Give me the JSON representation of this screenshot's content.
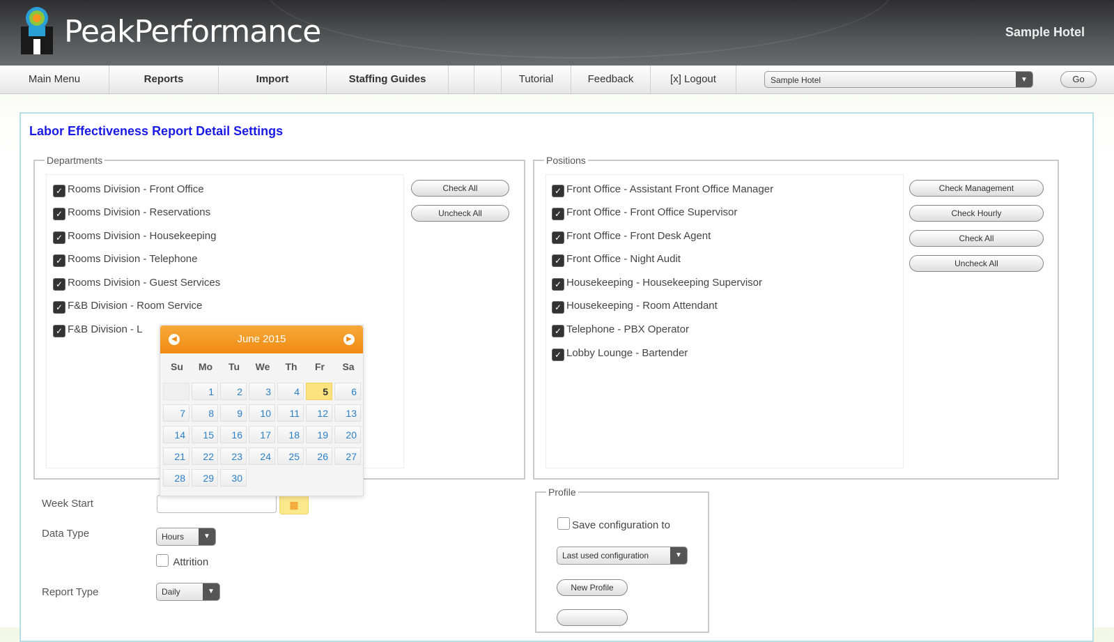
{
  "header": {
    "brand_bold": "Peak",
    "brand_light": "Performance",
    "hotel_name": "Sample Hotel"
  },
  "nav": {
    "items": [
      "Main Menu",
      "Reports",
      "Import",
      "Staffing Guides",
      "",
      "",
      "Tutorial",
      "Feedback",
      "[x] Logout"
    ],
    "hotel_select": "Sample Hotel",
    "go": "Go"
  },
  "page_title": "Labor Effectiveness Report Detail Settings",
  "departments": {
    "legend": "Departments",
    "items": [
      "Rooms Division - Front Office",
      "Rooms Division - Reservations",
      "Rooms Division - Housekeeping",
      "Rooms Division - Telephone",
      "Rooms Division - Guest Services",
      "F&B Division - Room Service",
      "F&B Division - L"
    ],
    "check_all": "Check All",
    "uncheck_all": "Uncheck All"
  },
  "positions": {
    "legend": "Positions",
    "items": [
      "Front Office - Assistant Front Office Manager",
      "Front Office - Front Office Supervisor",
      "Front Office - Front Desk Agent",
      "Front Office - Night Audit",
      "Housekeeping - Housekeeping Supervisor",
      "Housekeeping - Room Attendant",
      "Telephone - PBX Operator",
      "Lobby Lounge - Bartender"
    ],
    "check_management": "Check Management",
    "check_hourly": "Check Hourly",
    "check_all": "Check All",
    "uncheck_all": "Uncheck All"
  },
  "calendar": {
    "month": "June 2015",
    "days_of_week": [
      "Su",
      "Mo",
      "Tu",
      "We",
      "Th",
      "Fr",
      "Sa"
    ],
    "days": [
      "1",
      "2",
      "3",
      "4",
      "5",
      "6",
      "7",
      "8",
      "9",
      "10",
      "11",
      "12",
      "13",
      "14",
      "15",
      "16",
      "17",
      "18",
      "19",
      "20",
      "21",
      "22",
      "23",
      "24",
      "25",
      "26",
      "27",
      "28",
      "29",
      "30"
    ],
    "today": "5"
  },
  "form": {
    "week_start_label": "Week Start",
    "week_start_value": "",
    "data_type_label": "Data Type",
    "data_type_value": "Hours",
    "attrition_label": "Attrition",
    "report_type_label": "Report Type",
    "report_type_value": "Daily"
  },
  "profile": {
    "legend": "Profile",
    "save_label": "Save configuration to",
    "config_select": "Last used configuration",
    "new_profile": "New Profile"
  },
  "colors": {
    "title_blue": "#1a1ae6",
    "calendar_orange": "#f08a12",
    "today_yellow": "#fbe27c"
  }
}
